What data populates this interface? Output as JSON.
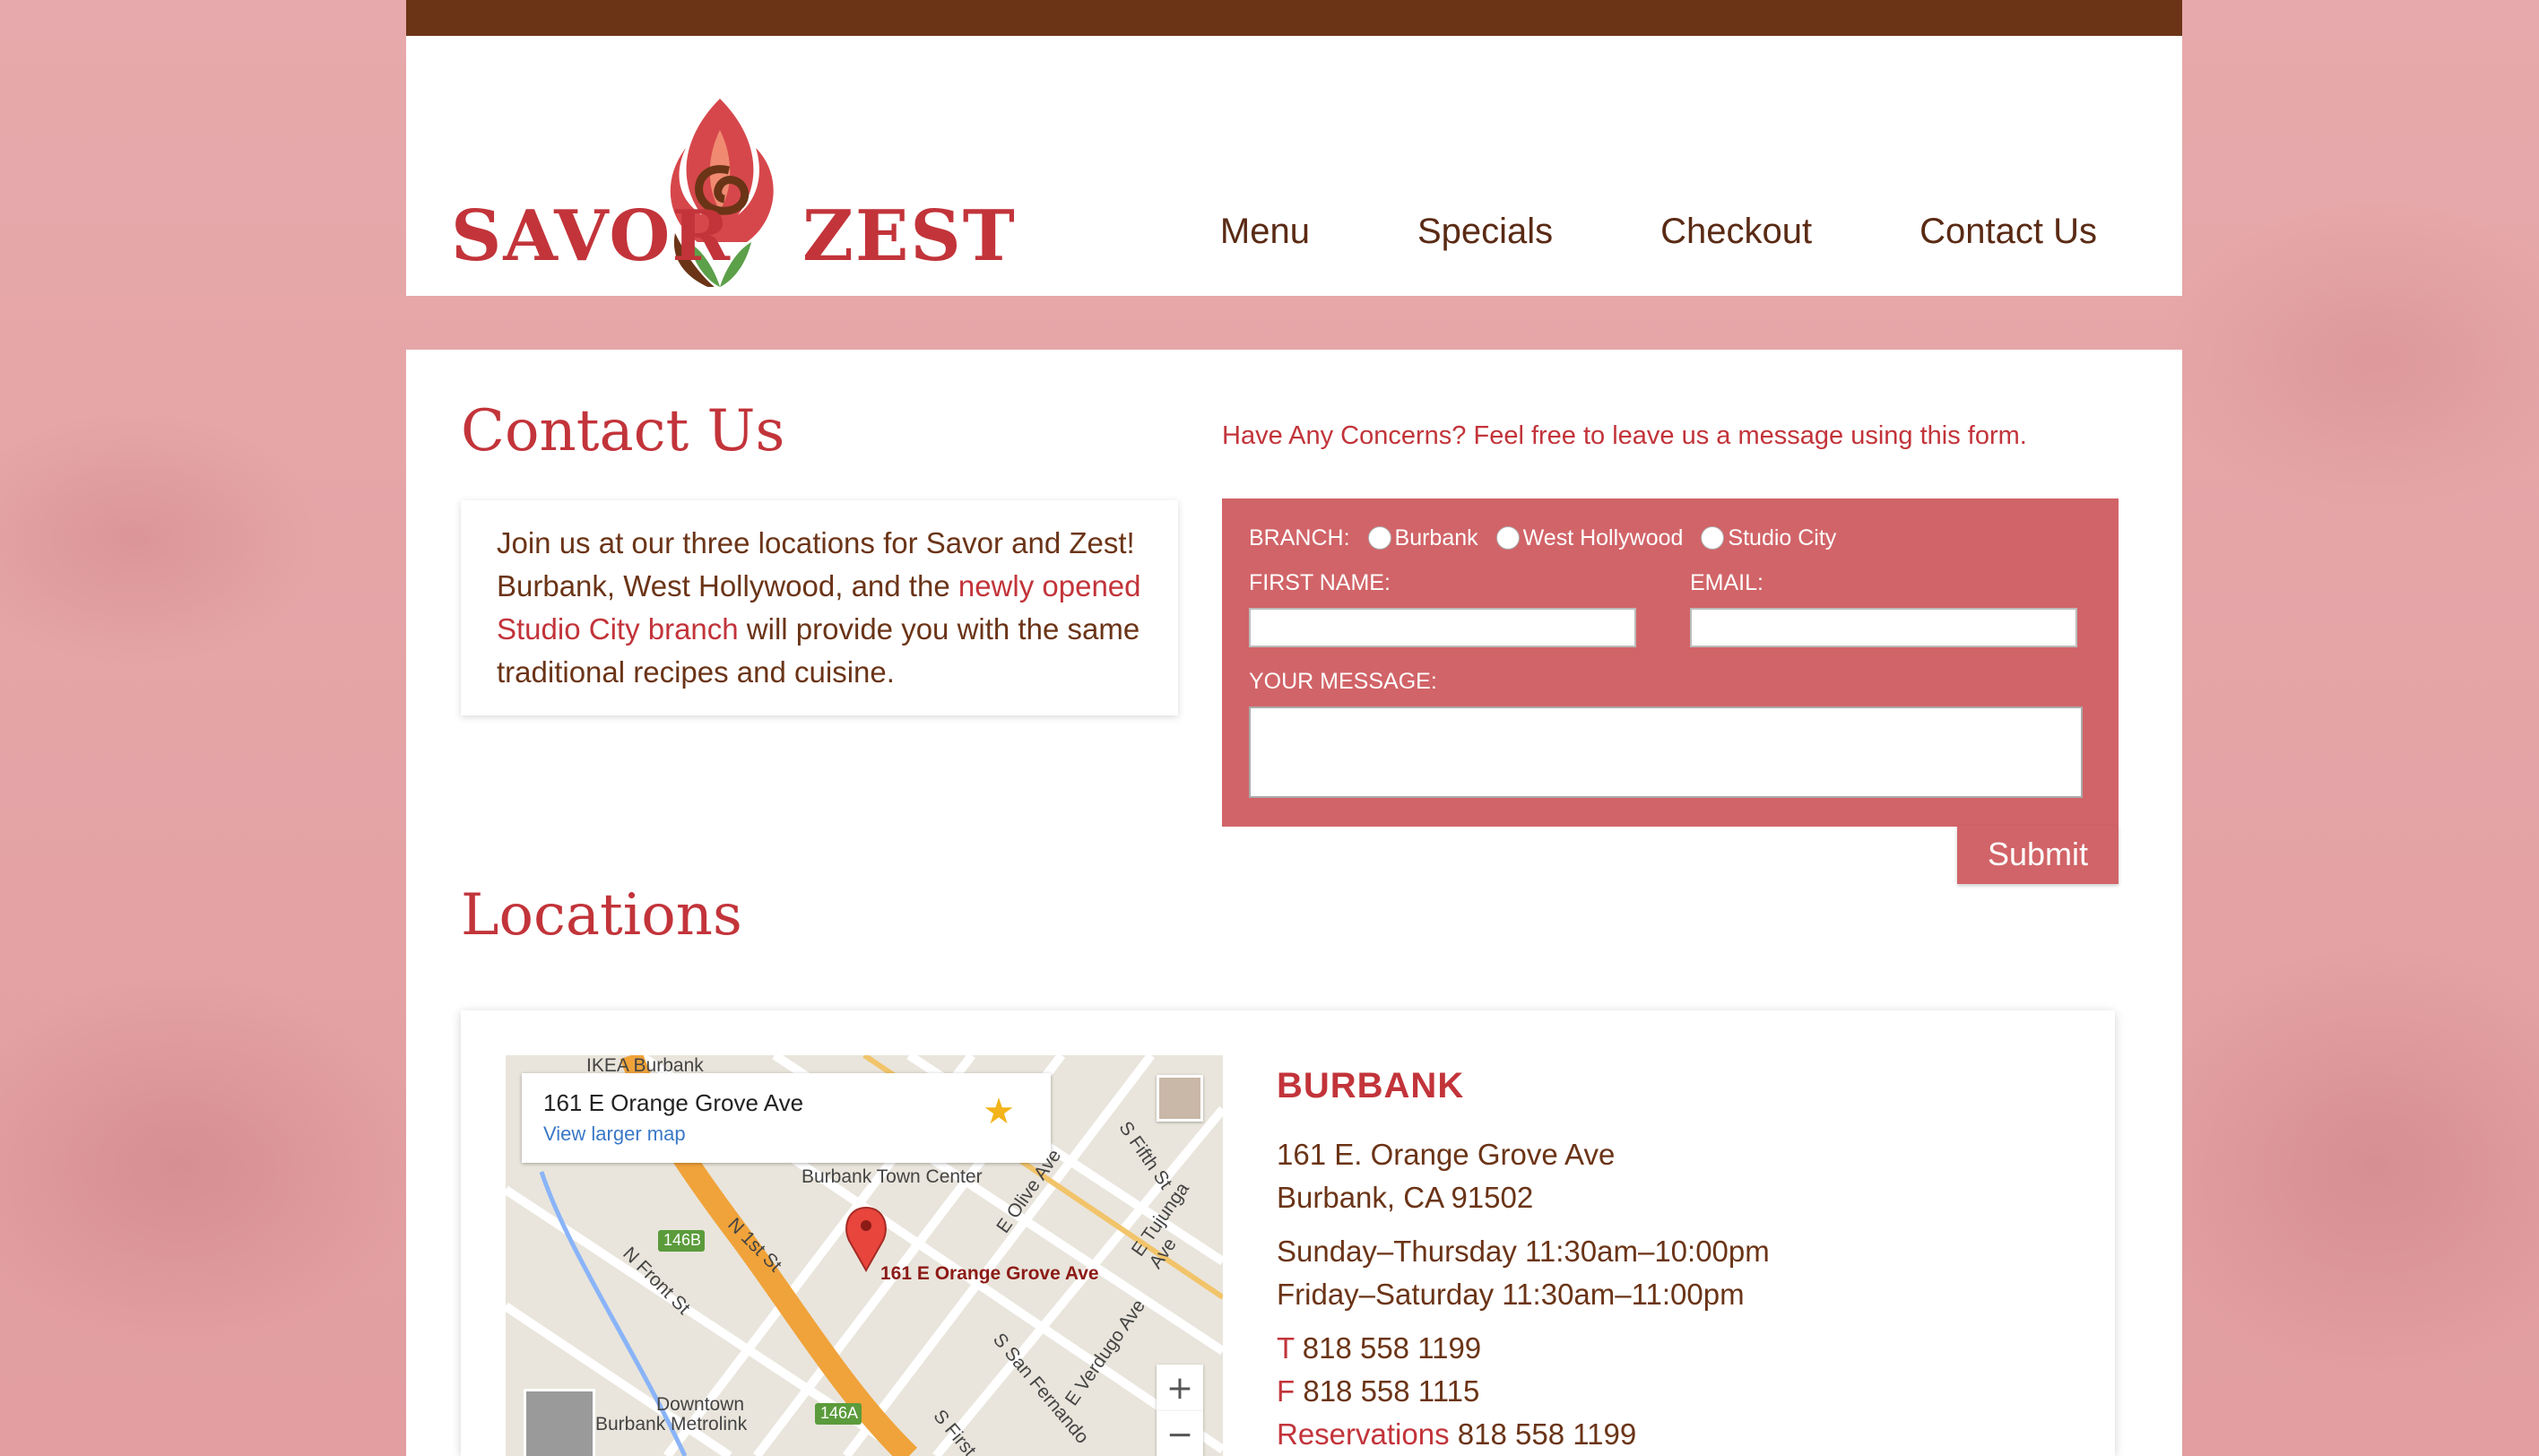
{
  "brand": {
    "logo_left": "SAVOR",
    "logo_right": "ZEST",
    "colors": {
      "topbar": "#6b3417",
      "accent": "#c2343a",
      "form_panel": "#d16468",
      "text": "#6b3417"
    }
  },
  "nav": {
    "items": [
      "Menu",
      "Specials",
      "Checkout",
      "Contact Us"
    ]
  },
  "contact": {
    "title": "Contact Us",
    "intro_part1": "Join us at our three locations for Savor and Zest! Burbank, West Hollywood, and the ",
    "intro_link": "newly opened Studio City branch",
    "intro_part2": " will provide you with the same traditional recipes and cuisine.",
    "concerns": "Have Any Concerns? Feel free to leave us a message using this form."
  },
  "form": {
    "branch_label": "BRANCH:",
    "branches": [
      "Burbank",
      "West Hollywood",
      "Studio City"
    ],
    "first_name_label": "FIRST NAME:",
    "email_label": "EMAIL:",
    "first_name_value": "",
    "email_value": "",
    "message_label": "YOUR MESSAGE:",
    "message_value": "",
    "submit_label": "Submit"
  },
  "locations": {
    "title": "Locations",
    "burbank": {
      "name": "BURBANK",
      "address1": "161 E. Orange Grove Ave",
      "address2": "Burbank, CA 91502",
      "hours1": "Sunday–Thursday 11:30am–10:00pm",
      "hours2": "Friday–Saturday 11:30am–11:00pm",
      "phone_label": "T",
      "phone": "818 558 1199",
      "fax_label": "F",
      "fax": "818 558 1115",
      "reservations_label": "Reservations",
      "reservations": "818 558 1199"
    },
    "map": {
      "infobox_address": "161 E Orange Grove Ave",
      "infobox_link": "View larger map",
      "pin_label": "161 E Orange Grove Ave",
      "labels": {
        "ikea": "IKEA Burbank",
        "town_center": "Burbank Town Center",
        "n_front": "N Front St",
        "n_1st": "N 1st St",
        "e_olive": "E Olive Ave",
        "s_fifth": "S Fifth St",
        "e_tujunga": "E Tujunga Ave",
        "downtown": "Downtown",
        "metrolink": "Burbank Metrolink",
        "s_san_fernando": "S San Fernando",
        "e_verdugo": "E Verdugo Ave",
        "s_first": "S First",
        "hwy_146b": "146B",
        "hwy_146a": "146A",
        "zoom_in": "+",
        "zoom_out": "−"
      }
    }
  }
}
